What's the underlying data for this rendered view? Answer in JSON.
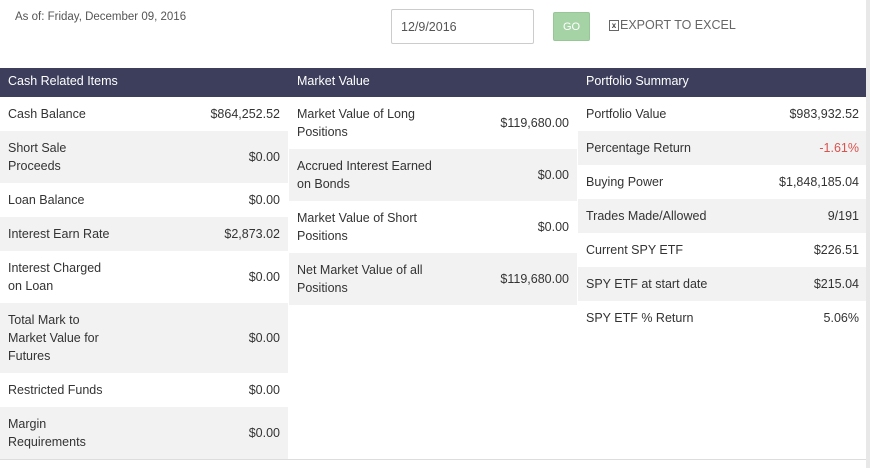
{
  "as_of": "As of: Friday, December 09, 2016",
  "date_value": "12/9/2016",
  "go_label": "GO",
  "export_label": "EXPORT TO EXCEL",
  "export_icon": "x",
  "sections": {
    "cash": {
      "title": "Cash Related Items",
      "rows": [
        {
          "label": "Cash Balance",
          "value": "$864,252.52"
        },
        {
          "label": "Short Sale Proceeds",
          "value": "$0.00"
        },
        {
          "label": "Loan Balance",
          "value": "$0.00"
        },
        {
          "label": "Interest Earn Rate",
          "value": "$2,873.02"
        },
        {
          "label": "Interest Charged on Loan",
          "value": "$0.00"
        },
        {
          "label": "Total Mark to Market Value for Futures",
          "value": "$0.00"
        },
        {
          "label": "Restricted Funds",
          "value": "$0.00"
        },
        {
          "label": "Margin Requirements",
          "value": "$0.00"
        }
      ]
    },
    "market": {
      "title": "Market Value",
      "rows": [
        {
          "label": "Market Value of Long Positions",
          "value": "$119,680.00"
        },
        {
          "label": "Accrued Interest Earned on Bonds",
          "value": "$0.00"
        },
        {
          "label": "Market Value of Short Positions",
          "value": "$0.00"
        },
        {
          "label": "Net Market Value of all Positions",
          "value": "$119,680.00"
        }
      ]
    },
    "portfolio": {
      "title": "Portfolio Summary",
      "rows": [
        {
          "label": "Portfolio Value",
          "value": "$983,932.52"
        },
        {
          "label": "Percentage Return",
          "value": "-1.61%"
        },
        {
          "label": "Buying Power",
          "value": "$1,848,185.04"
        },
        {
          "label": "Trades Made/Allowed",
          "value": "9/191"
        },
        {
          "label": "Current SPY ETF",
          "value": "$226.51"
        },
        {
          "label": "SPY ETF at start date",
          "value": "$215.04"
        },
        {
          "label": "SPY ETF % Return",
          "value": "5.06%"
        }
      ]
    }
  },
  "colors": {
    "header_bg": "#3c3e5c",
    "alt_row_bg": "#f2f2f2",
    "negative": "#d9534f",
    "go_button": "#a6d3a6"
  }
}
